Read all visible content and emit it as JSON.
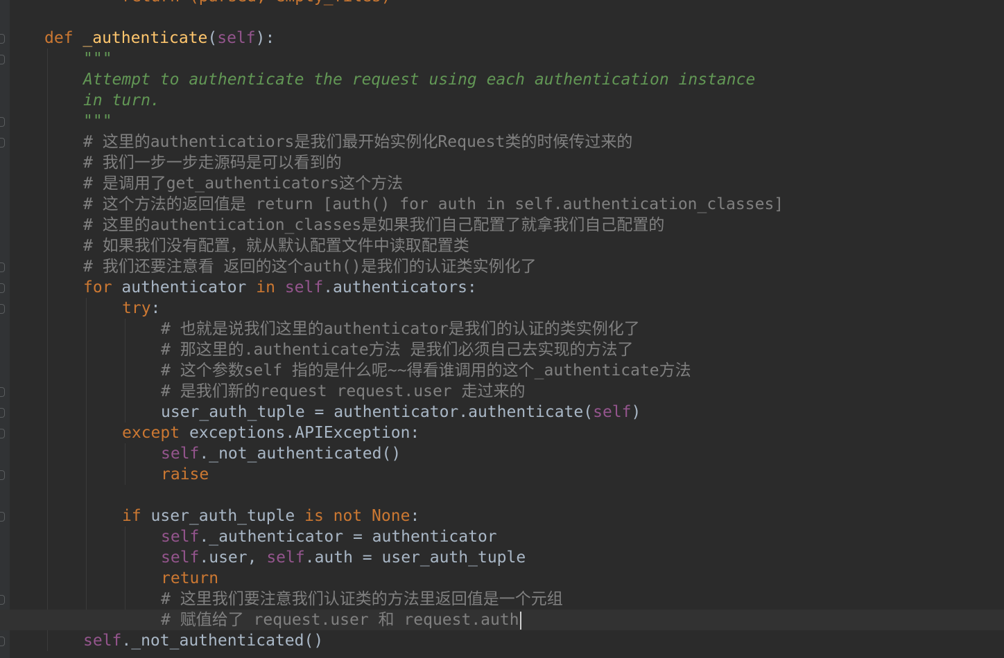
{
  "theme_colors": {
    "keyword": "#cc7832",
    "self": "#94558d",
    "function_name": "#ffc66d",
    "docstring": "#629755",
    "comment": "#808080",
    "default": "#a9b7c6",
    "background": "#2b2b2b"
  },
  "code_lines": [
    {
      "indent": 3,
      "tokens": [
        {
          "t": "return (parsed, empty_files)",
          "c": "keyword"
        }
      ],
      "clip": true
    },
    {
      "indent": 0,
      "tokens": []
    },
    {
      "indent": 1,
      "tokens": [
        {
          "t": "def ",
          "c": "keyword"
        },
        {
          "t": "_authenticate",
          "c": "function_name"
        },
        {
          "t": "(",
          "c": "default"
        },
        {
          "t": "self",
          "c": "self"
        },
        {
          "t": "):",
          "c": "default"
        }
      ]
    },
    {
      "indent": 2,
      "tokens": [
        {
          "t": "\"\"\"",
          "c": "docstring"
        }
      ]
    },
    {
      "indent": 2,
      "tokens": [
        {
          "t": "Attempt to authenticate the request using each authentication instance",
          "c": "docstring"
        }
      ],
      "italic": true
    },
    {
      "indent": 2,
      "tokens": [
        {
          "t": "in turn.",
          "c": "docstring"
        }
      ],
      "italic": true
    },
    {
      "indent": 2,
      "tokens": [
        {
          "t": "\"\"\"",
          "c": "docstring"
        }
      ]
    },
    {
      "indent": 2,
      "tokens": [
        {
          "t": "# 这里的authenticatiors是我们最开始实例化Request类的时候传过来的",
          "c": "comment"
        }
      ]
    },
    {
      "indent": 2,
      "tokens": [
        {
          "t": "# 我们一步一步走源码是可以看到的",
          "c": "comment"
        }
      ]
    },
    {
      "indent": 2,
      "tokens": [
        {
          "t": "# 是调用了get_authenticators这个方法",
          "c": "comment"
        }
      ]
    },
    {
      "indent": 2,
      "tokens": [
        {
          "t": "# 这个方法的返回值是 return [auth() for auth in self.authentication_classes]",
          "c": "comment"
        }
      ]
    },
    {
      "indent": 2,
      "tokens": [
        {
          "t": "# 这里的authentication_classes是如果我们自己配置了就拿我们自己配置的",
          "c": "comment"
        }
      ]
    },
    {
      "indent": 2,
      "tokens": [
        {
          "t": "# 如果我们没有配置，就从默认配置文件中读取配置类",
          "c": "comment"
        }
      ]
    },
    {
      "indent": 2,
      "tokens": [
        {
          "t": "# 我们还要注意看 返回的这个auth()是我们的认证类实例化了",
          "c": "comment"
        }
      ]
    },
    {
      "indent": 2,
      "tokens": [
        {
          "t": "for ",
          "c": "keyword"
        },
        {
          "t": "authenticator ",
          "c": "default"
        },
        {
          "t": "in ",
          "c": "keyword"
        },
        {
          "t": "self",
          "c": "self"
        },
        {
          "t": ".authenticators:",
          "c": "default"
        }
      ]
    },
    {
      "indent": 3,
      "tokens": [
        {
          "t": "try",
          "c": "keyword"
        },
        {
          "t": ":",
          "c": "default"
        }
      ]
    },
    {
      "indent": 4,
      "tokens": [
        {
          "t": "# 也就是说我们这里的authenticator是我们的认证的类实例化了",
          "c": "comment"
        }
      ]
    },
    {
      "indent": 4,
      "tokens": [
        {
          "t": "# 那这里的.authenticate方法 是我们必须自己去实现的方法了",
          "c": "comment"
        }
      ]
    },
    {
      "indent": 4,
      "tokens": [
        {
          "t": "# 这个参数self 指的是什么呢~~得看谁调用的这个_authenticate方法",
          "c": "comment"
        }
      ]
    },
    {
      "indent": 4,
      "tokens": [
        {
          "t": "# 是我们新的request request.user 走过来的",
          "c": "comment"
        }
      ]
    },
    {
      "indent": 4,
      "tokens": [
        {
          "t": "user_auth_tuple = authenticator.authenticate(",
          "c": "default"
        },
        {
          "t": "self",
          "c": "self"
        },
        {
          "t": ")",
          "c": "default"
        }
      ]
    },
    {
      "indent": 3,
      "tokens": [
        {
          "t": "except ",
          "c": "keyword"
        },
        {
          "t": "exceptions.APIException:",
          "c": "default"
        }
      ]
    },
    {
      "indent": 4,
      "tokens": [
        {
          "t": "self",
          "c": "self"
        },
        {
          "t": "._not_authenticated()",
          "c": "default"
        }
      ]
    },
    {
      "indent": 4,
      "tokens": [
        {
          "t": "raise",
          "c": "keyword"
        }
      ]
    },
    {
      "indent": 0,
      "tokens": []
    },
    {
      "indent": 3,
      "tokens": [
        {
          "t": "if ",
          "c": "keyword"
        },
        {
          "t": "user_auth_tuple ",
          "c": "default"
        },
        {
          "t": "is not None",
          "c": "keyword"
        },
        {
          "t": ":",
          "c": "default"
        }
      ]
    },
    {
      "indent": 4,
      "tokens": [
        {
          "t": "self",
          "c": "self"
        },
        {
          "t": "._authenticator = authenticator",
          "c": "default"
        }
      ]
    },
    {
      "indent": 4,
      "tokens": [
        {
          "t": "self",
          "c": "self"
        },
        {
          "t": ".user, ",
          "c": "default"
        },
        {
          "t": "self",
          "c": "self"
        },
        {
          "t": ".auth = user_auth_tuple",
          "c": "default"
        }
      ]
    },
    {
      "indent": 4,
      "tokens": [
        {
          "t": "return",
          "c": "keyword"
        }
      ]
    },
    {
      "indent": 4,
      "tokens": [
        {
          "t": "# 这里我们要注意我们认证类的方法里返回值是一个元组",
          "c": "comment"
        }
      ]
    },
    {
      "indent": 4,
      "tokens": [
        {
          "t": "# 赋值给了 request.user 和 request.auth",
          "c": "comment"
        }
      ],
      "current": true,
      "caret": true
    },
    {
      "indent": 2,
      "tokens": [
        {
          "t": "self",
          "c": "self"
        },
        {
          "t": "._not_authenticated()",
          "c": "default"
        }
      ]
    }
  ]
}
